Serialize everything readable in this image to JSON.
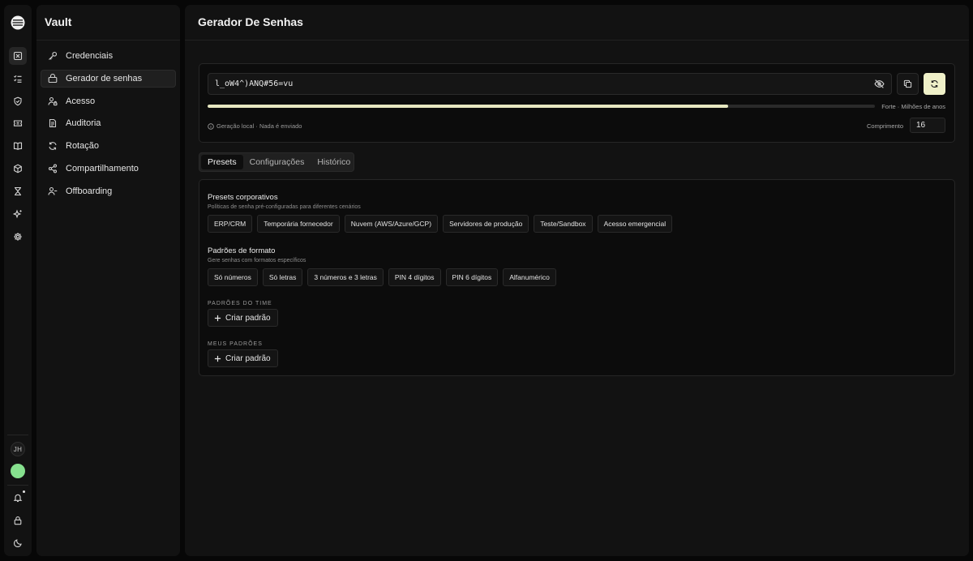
{
  "rail": {
    "avatar_initials": "JH",
    "items": [
      "shield-x-icon",
      "list-check-icon",
      "shield-check-icon",
      "ticket-icon",
      "book-icon",
      "box-icon",
      "hourglass-icon",
      "sparkles-icon",
      "settings-icon"
    ]
  },
  "sidebar": {
    "title": "Vault",
    "items": [
      {
        "label": "Credenciais",
        "icon": "key-icon"
      },
      {
        "label": "Gerador de senhas",
        "icon": "password-generator-icon",
        "active": true
      },
      {
        "label": "Acesso",
        "icon": "user-lock-icon"
      },
      {
        "label": "Auditoria",
        "icon": "audit-icon"
      },
      {
        "label": "Rotação",
        "icon": "refresh-icon"
      },
      {
        "label": "Compartilhamento",
        "icon": "share-icon"
      },
      {
        "label": "Offboarding",
        "icon": "user-minus-icon"
      }
    ]
  },
  "page": {
    "title": "Gerador De Senhas"
  },
  "generator": {
    "password": "l_oW4^)ANQ#56=vu",
    "strength_fraction": 0.78,
    "strength_label": "Forte · Milhões de anos",
    "local_note": "Geração local · Nada é enviado",
    "length_label": "Comprimento",
    "length_value": "16",
    "accent_color": "#eff0c8"
  },
  "tabs": [
    "Presets",
    "Configurações",
    "Histórico"
  ],
  "presets": {
    "corporate": {
      "title": "Presets corporativos",
      "subtitle": "Políticas de senha pré-configuradas para diferentes cenários",
      "chips": [
        "ERP/CRM",
        "Temporária fornecedor",
        "Nuvem (AWS/Azure/GCP)",
        "Servidores de produção",
        "Teste/Sandbox",
        "Acesso emergencial"
      ]
    },
    "format": {
      "title": "Padrões de formato",
      "subtitle": "Gere senhas com formatos específicos",
      "chips": [
        "Só números",
        "Só letras",
        "3 números e 3 letras",
        "PIN 4 dígitos",
        "PIN 6 dígitos",
        "Alfanumérico"
      ]
    },
    "team": {
      "label": "PADRÕES DO TIME",
      "button": "Criar padrão"
    },
    "mine": {
      "label": "MEUS PADRÕES",
      "button": "Criar padrão"
    }
  }
}
